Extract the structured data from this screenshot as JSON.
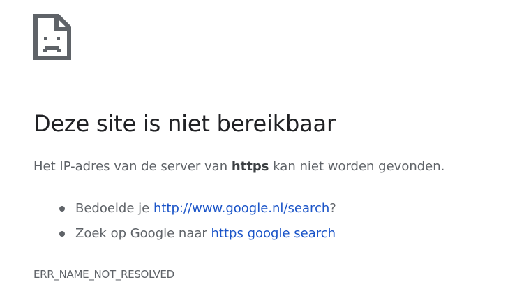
{
  "error": {
    "icon": "sad-page-icon",
    "title": "Deze site is niet bereikbaar",
    "summary": {
      "prefix": "Het IP-adres van de server van ",
      "host": "https",
      "suffix": " kan niet worden gevonden."
    },
    "suggestions": [
      {
        "prefix": "Bedoelde je ",
        "link": "http://www.google.nl/search",
        "suffix": "?"
      },
      {
        "prefix": "Zoek op Google naar ",
        "link": "https google search",
        "suffix": ""
      }
    ],
    "code": "ERR_NAME_NOT_RESOLVED"
  },
  "colors": {
    "title": "#202124",
    "text": "#5f6368",
    "link": "#1a54c8",
    "icon": "#5f6368"
  }
}
